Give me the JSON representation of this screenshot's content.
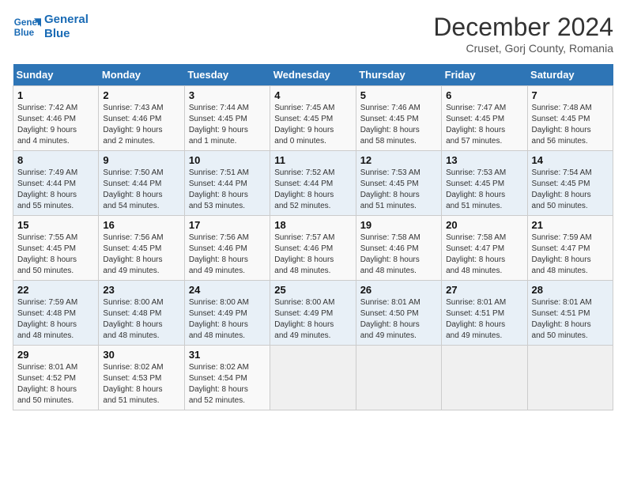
{
  "logo": {
    "line1": "General",
    "line2": "Blue"
  },
  "title": "December 2024",
  "subtitle": "Cruset, Gorj County, Romania",
  "days_header": [
    "Sunday",
    "Monday",
    "Tuesday",
    "Wednesday",
    "Thursday",
    "Friday",
    "Saturday"
  ],
  "weeks": [
    [
      {
        "num": "1",
        "info": "Sunrise: 7:42 AM\nSunset: 4:46 PM\nDaylight: 9 hours\nand 4 minutes."
      },
      {
        "num": "2",
        "info": "Sunrise: 7:43 AM\nSunset: 4:46 PM\nDaylight: 9 hours\nand 2 minutes."
      },
      {
        "num": "3",
        "info": "Sunrise: 7:44 AM\nSunset: 4:45 PM\nDaylight: 9 hours\nand 1 minute."
      },
      {
        "num": "4",
        "info": "Sunrise: 7:45 AM\nSunset: 4:45 PM\nDaylight: 9 hours\nand 0 minutes."
      },
      {
        "num": "5",
        "info": "Sunrise: 7:46 AM\nSunset: 4:45 PM\nDaylight: 8 hours\nand 58 minutes."
      },
      {
        "num": "6",
        "info": "Sunrise: 7:47 AM\nSunset: 4:45 PM\nDaylight: 8 hours\nand 57 minutes."
      },
      {
        "num": "7",
        "info": "Sunrise: 7:48 AM\nSunset: 4:45 PM\nDaylight: 8 hours\nand 56 minutes."
      }
    ],
    [
      {
        "num": "8",
        "info": "Sunrise: 7:49 AM\nSunset: 4:44 PM\nDaylight: 8 hours\nand 55 minutes."
      },
      {
        "num": "9",
        "info": "Sunrise: 7:50 AM\nSunset: 4:44 PM\nDaylight: 8 hours\nand 54 minutes."
      },
      {
        "num": "10",
        "info": "Sunrise: 7:51 AM\nSunset: 4:44 PM\nDaylight: 8 hours\nand 53 minutes."
      },
      {
        "num": "11",
        "info": "Sunrise: 7:52 AM\nSunset: 4:44 PM\nDaylight: 8 hours\nand 52 minutes."
      },
      {
        "num": "12",
        "info": "Sunrise: 7:53 AM\nSunset: 4:45 PM\nDaylight: 8 hours\nand 51 minutes."
      },
      {
        "num": "13",
        "info": "Sunrise: 7:53 AM\nSunset: 4:45 PM\nDaylight: 8 hours\nand 51 minutes."
      },
      {
        "num": "14",
        "info": "Sunrise: 7:54 AM\nSunset: 4:45 PM\nDaylight: 8 hours\nand 50 minutes."
      }
    ],
    [
      {
        "num": "15",
        "info": "Sunrise: 7:55 AM\nSunset: 4:45 PM\nDaylight: 8 hours\nand 50 minutes."
      },
      {
        "num": "16",
        "info": "Sunrise: 7:56 AM\nSunset: 4:45 PM\nDaylight: 8 hours\nand 49 minutes."
      },
      {
        "num": "17",
        "info": "Sunrise: 7:56 AM\nSunset: 4:46 PM\nDaylight: 8 hours\nand 49 minutes."
      },
      {
        "num": "18",
        "info": "Sunrise: 7:57 AM\nSunset: 4:46 PM\nDaylight: 8 hours\nand 48 minutes."
      },
      {
        "num": "19",
        "info": "Sunrise: 7:58 AM\nSunset: 4:46 PM\nDaylight: 8 hours\nand 48 minutes."
      },
      {
        "num": "20",
        "info": "Sunrise: 7:58 AM\nSunset: 4:47 PM\nDaylight: 8 hours\nand 48 minutes."
      },
      {
        "num": "21",
        "info": "Sunrise: 7:59 AM\nSunset: 4:47 PM\nDaylight: 8 hours\nand 48 minutes."
      }
    ],
    [
      {
        "num": "22",
        "info": "Sunrise: 7:59 AM\nSunset: 4:48 PM\nDaylight: 8 hours\nand 48 minutes."
      },
      {
        "num": "23",
        "info": "Sunrise: 8:00 AM\nSunset: 4:48 PM\nDaylight: 8 hours\nand 48 minutes."
      },
      {
        "num": "24",
        "info": "Sunrise: 8:00 AM\nSunset: 4:49 PM\nDaylight: 8 hours\nand 48 minutes."
      },
      {
        "num": "25",
        "info": "Sunrise: 8:00 AM\nSunset: 4:49 PM\nDaylight: 8 hours\nand 49 minutes."
      },
      {
        "num": "26",
        "info": "Sunrise: 8:01 AM\nSunset: 4:50 PM\nDaylight: 8 hours\nand 49 minutes."
      },
      {
        "num": "27",
        "info": "Sunrise: 8:01 AM\nSunset: 4:51 PM\nDaylight: 8 hours\nand 49 minutes."
      },
      {
        "num": "28",
        "info": "Sunrise: 8:01 AM\nSunset: 4:51 PM\nDaylight: 8 hours\nand 50 minutes."
      }
    ],
    [
      {
        "num": "29",
        "info": "Sunrise: 8:01 AM\nSunset: 4:52 PM\nDaylight: 8 hours\nand 50 minutes."
      },
      {
        "num": "30",
        "info": "Sunrise: 8:02 AM\nSunset: 4:53 PM\nDaylight: 8 hours\nand 51 minutes."
      },
      {
        "num": "31",
        "info": "Sunrise: 8:02 AM\nSunset: 4:54 PM\nDaylight: 8 hours\nand 52 minutes."
      },
      null,
      null,
      null,
      null
    ]
  ]
}
